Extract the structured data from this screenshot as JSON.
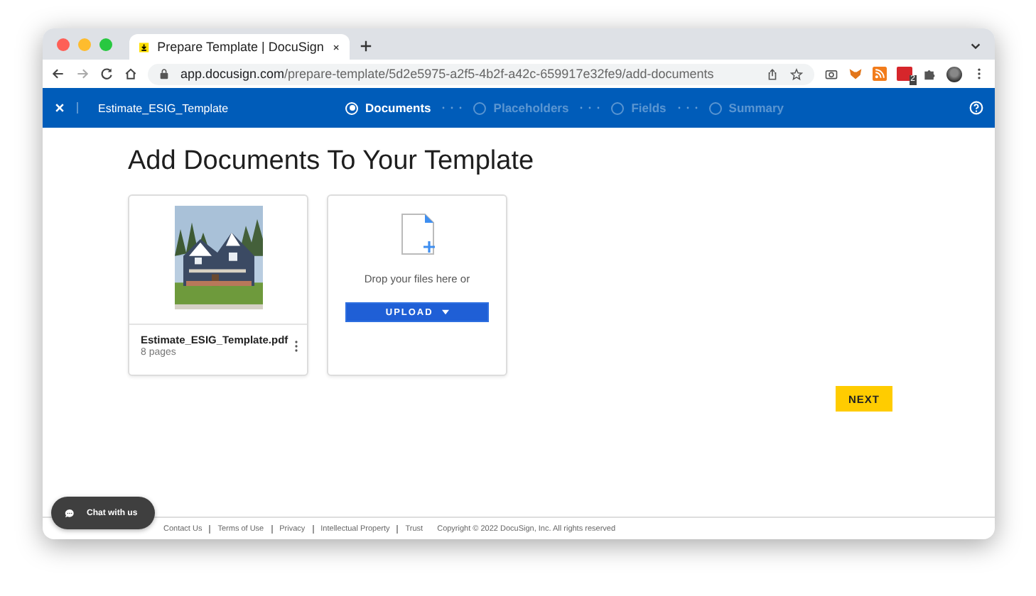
{
  "browser": {
    "tab": {
      "title": "Prepare Template | DocuSign"
    },
    "url": {
      "host": "app.docusign.com",
      "path": "/prepare-template/5d2e5975-a2f5-4b2f-a42c-659917e32fe9/add-documents"
    },
    "extension_badge": "2"
  },
  "nav": {
    "template_name": "Estimate_ESIG_Template",
    "steps": [
      {
        "label": "Documents",
        "selected": true
      },
      {
        "label": "Placeholders",
        "selected": false
      },
      {
        "label": "Fields",
        "selected": false
      },
      {
        "label": "Summary",
        "selected": false
      }
    ]
  },
  "heading": "Add Documents To Your Template",
  "documents": [
    {
      "name": "Estimate_ESIG_Template.pdf",
      "pages": "8 pages"
    }
  ],
  "upload": {
    "prompt": "Drop your files here or",
    "button": "UPLOAD"
  },
  "next_button": "NEXT",
  "chat_button": "Chat with us",
  "footer": {
    "links": [
      "Contact Us",
      "Terms of Use",
      "Privacy",
      "Intellectual Property",
      "Trust"
    ],
    "copyright": "Copyright © 2022 DocuSign, Inc. All rights reserved"
  }
}
